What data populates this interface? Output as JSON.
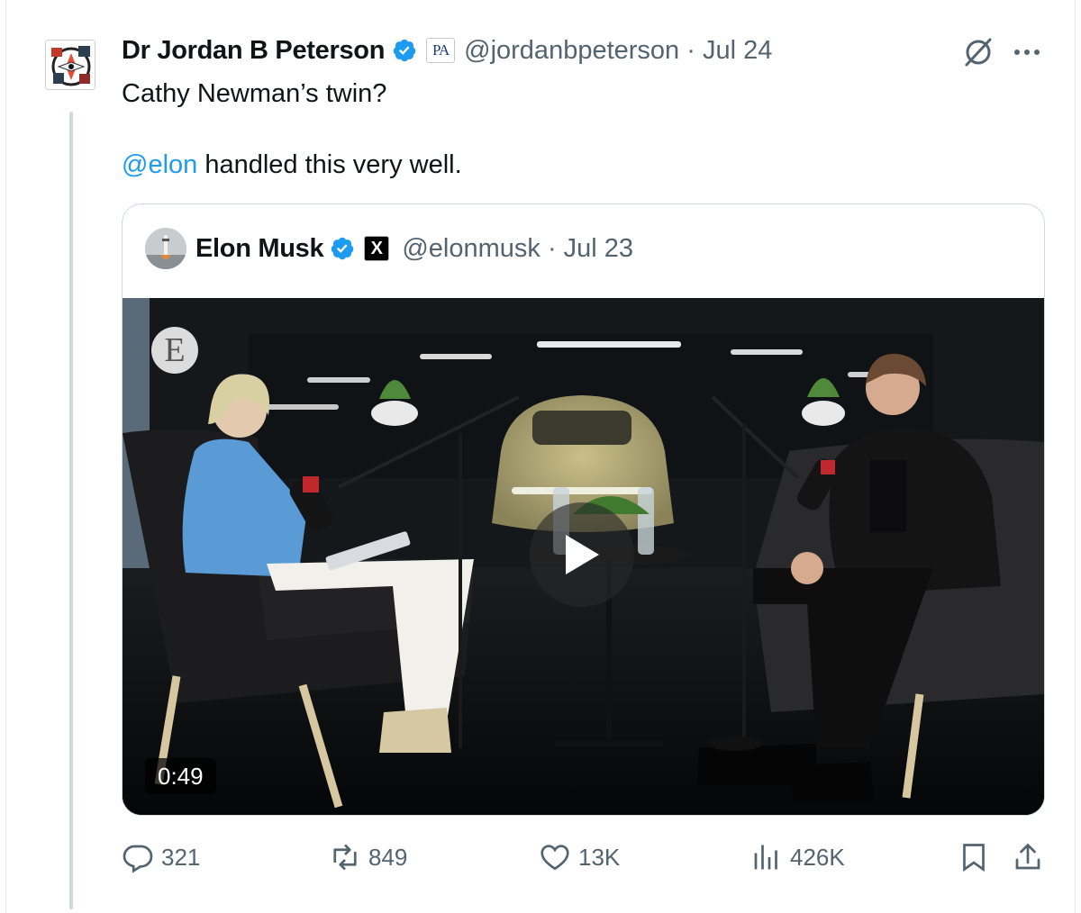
{
  "tweet": {
    "author_name": "Dr Jordan B Peterson",
    "affiliation_label": "PA",
    "handle_date": "@jordanbpeterson · Jul 24",
    "text_line1": "Cathy Newman’s twin?",
    "mention": "@elon",
    "text_line2_rest": " handled this very well."
  },
  "quote": {
    "author_name": "Elon Musk",
    "affiliation_label": "X",
    "handle_date": "@elonmusk · Jul 23",
    "video_brand": "E",
    "video_duration": "0:49"
  },
  "actions": {
    "replies": "321",
    "reposts": "849",
    "likes": "13K",
    "views": "426K"
  },
  "colors": {
    "accent": "#1d9bf0",
    "secondary_text": "#536471",
    "border": "#cfd9de"
  },
  "icons": [
    "verified-badge-icon",
    "grok-icon",
    "more-icon",
    "reply-icon",
    "repost-icon",
    "like-icon",
    "views-icon",
    "bookmark-icon",
    "share-icon",
    "play-icon"
  ]
}
